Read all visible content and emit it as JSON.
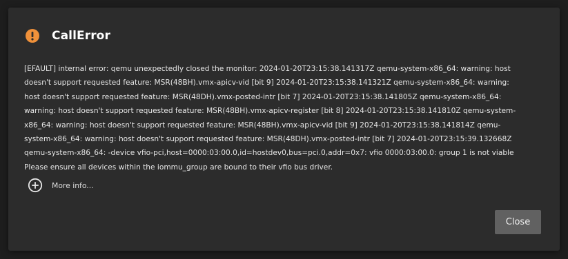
{
  "dialog": {
    "icon": "warning-icon",
    "title": "CallError",
    "message_lines": [
      "[EFAULT] internal error: qemu unexpectedly closed the monitor: 2024-01-20T23:15:38.141317Z qemu-system-x86_64: warning: host",
      "doesn't support requested feature: MSR(48BH).vmx-apicv-vid [bit 9] 2024-01-20T23:15:38.141321Z qemu-system-x86_64: warning:",
      "host doesn't support requested feature: MSR(48DH).vmx-posted-intr [bit 7] 2024-01-20T23:15:38.141805Z qemu-system-x86_64:",
      "warning: host doesn't support requested feature: MSR(48BH).vmx-apicv-register [bit 8] 2024-01-20T23:15:38.141810Z qemu-system-",
      "x86_64: warning: host doesn't support requested feature: MSR(48BH).vmx-apicv-vid [bit 9] 2024-01-20T23:15:38.141814Z qemu-",
      "system-x86_64: warning: host doesn't support requested feature: MSR(48DH).vmx-posted-intr [bit 7] 2024-01-20T23:15:39.132668Z",
      "qemu-system-x86_64: -device vfio-pci,host=0000:03:00.0,id=hostdev0,bus=pci.0,addr=0x7: vfio 0000:03:00.0: group 1 is not viable",
      "Please ensure all devices within the iommu_group are bound to their vfio bus driver."
    ],
    "more_info": {
      "icon": "plus-circle-icon",
      "label": "More info..."
    },
    "close_label": "Close"
  },
  "colors": {
    "backdrop": "#1e1e1e",
    "dialog_bg": "#2c2c2c",
    "warning": "#f0913a",
    "button_bg": "#616161",
    "text": "#e6e6e6"
  }
}
